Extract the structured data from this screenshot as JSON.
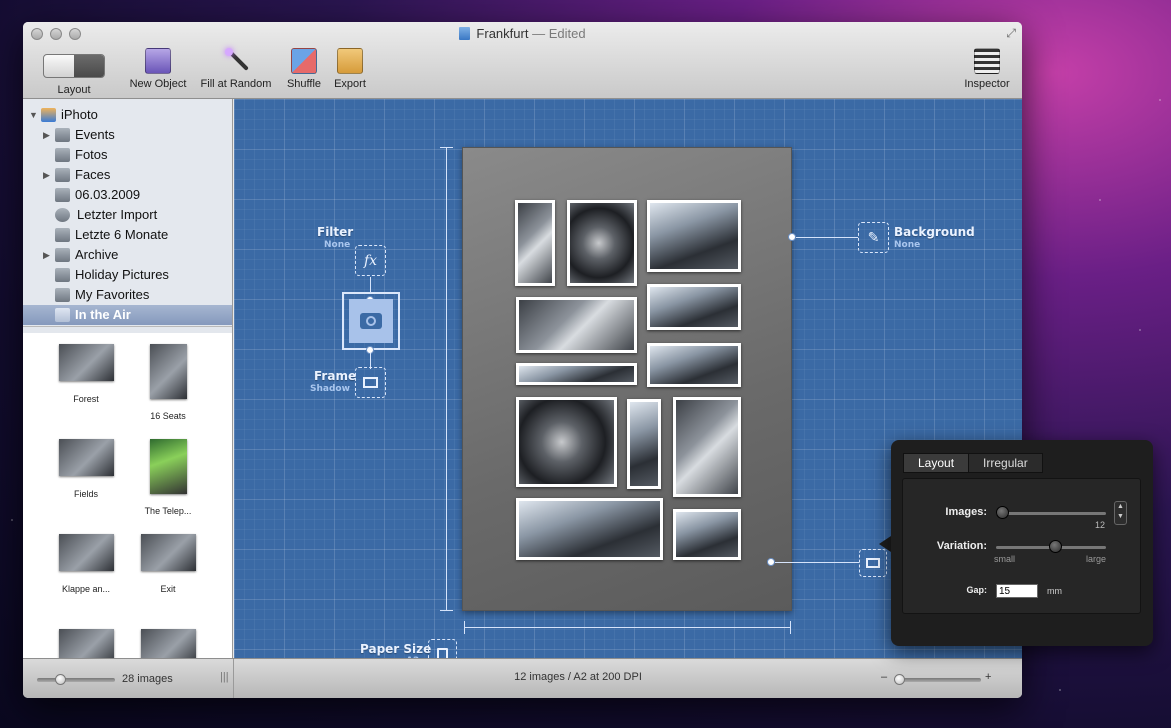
{
  "window": {
    "title": "Frankfurt",
    "status": "Edited"
  },
  "toolbar": {
    "layout_label": "Layout",
    "new_object_label": "New Object",
    "fill_random_label": "Fill at Random",
    "shuffle_label": "Shuffle",
    "export_label": "Export",
    "inspector_label": "Inspector"
  },
  "sidebar": {
    "sources": [
      {
        "label": "iPhoto",
        "icon": "iphoto-icon"
      },
      {
        "label": "Events",
        "icon": "events-icon"
      },
      {
        "label": "Fotos",
        "icon": "photos-icon"
      },
      {
        "label": "Faces",
        "icon": "faces-icon"
      },
      {
        "label": "06.03.2009",
        "icon": "event-icon"
      },
      {
        "label": "Letzter Import",
        "icon": "clock-icon"
      },
      {
        "label": "Letzte 6 Monate",
        "icon": "calendar-icon"
      },
      {
        "label": "Archive",
        "icon": "folder-icon"
      },
      {
        "label": "Holiday Pictures",
        "icon": "smart-album-icon"
      },
      {
        "label": "My Favorites",
        "icon": "smart-album-icon"
      },
      {
        "label": "In the Air",
        "icon": "album-icon"
      }
    ],
    "thumbnails": [
      "Forest",
      "16 Seats",
      "Fields",
      "The Telep...",
      "Klappe an...",
      "Exit"
    ],
    "image_count": "28 images"
  },
  "canvas": {
    "filter_label": "Filter",
    "filter_value": "None",
    "frame_label": "Frame",
    "frame_value": "Shadow",
    "background_label": "Background",
    "background_value": "None",
    "paper_label": "Paper Size",
    "paper_value": "A2"
  },
  "status": {
    "summary": "12 images / A2 at 200 DPI",
    "zoom_minus": "–",
    "zoom_plus": "+"
  },
  "inspector": {
    "tabs": [
      "Layout",
      "Irregular"
    ],
    "images_label": "Images:",
    "images_value": "12",
    "images_fraction": 0.0,
    "variation_label": "Variation:",
    "variation_min": "small",
    "variation_max": "large",
    "variation_fraction": 0.55,
    "gap_label": "Gap:",
    "gap_value": "15",
    "gap_unit": "mm"
  }
}
